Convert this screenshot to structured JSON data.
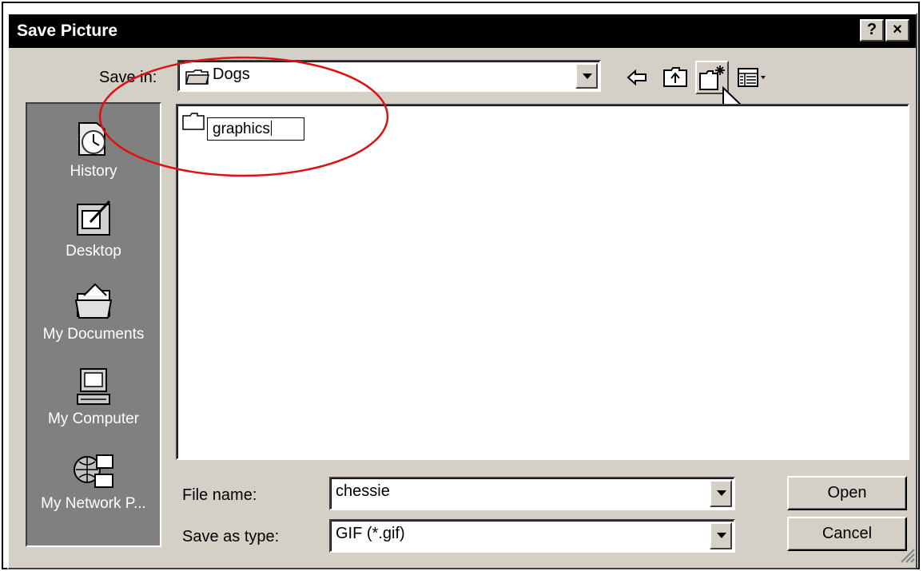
{
  "window": {
    "title": "Save Picture",
    "help_label": "?",
    "close_label": "×"
  },
  "save_in": {
    "label": "Save in:",
    "value": "Dogs"
  },
  "toolbar": {
    "icons": [
      "back-arrow-icon",
      "up-one-level-icon",
      "create-new-folder-icon",
      "views-menu-icon"
    ]
  },
  "places_bar": {
    "items": [
      {
        "label": "History",
        "icon": "history-icon"
      },
      {
        "label": "Desktop",
        "icon": "desktop-icon"
      },
      {
        "label": "My Documents",
        "icon": "my-documents-icon"
      },
      {
        "label": "My Computer",
        "icon": "my-computer-icon"
      },
      {
        "label": "My Network P...",
        "icon": "my-network-places-icon"
      }
    ]
  },
  "file_list": {
    "items": [
      {
        "name": "graphics",
        "state": "renaming",
        "icon": "folder-icon"
      }
    ]
  },
  "file_name": {
    "label": "File name:",
    "value": "chessie"
  },
  "save_as_type": {
    "label": "Save as type:",
    "value": "GIF (*.gif)"
  },
  "buttons": {
    "open_label": "Open",
    "cancel_label": "Cancel"
  },
  "colors": {
    "dialog_face": "#d4d0c8",
    "titlebar": "#000000",
    "places_bg": "#808080",
    "annotation": "#e01010"
  }
}
